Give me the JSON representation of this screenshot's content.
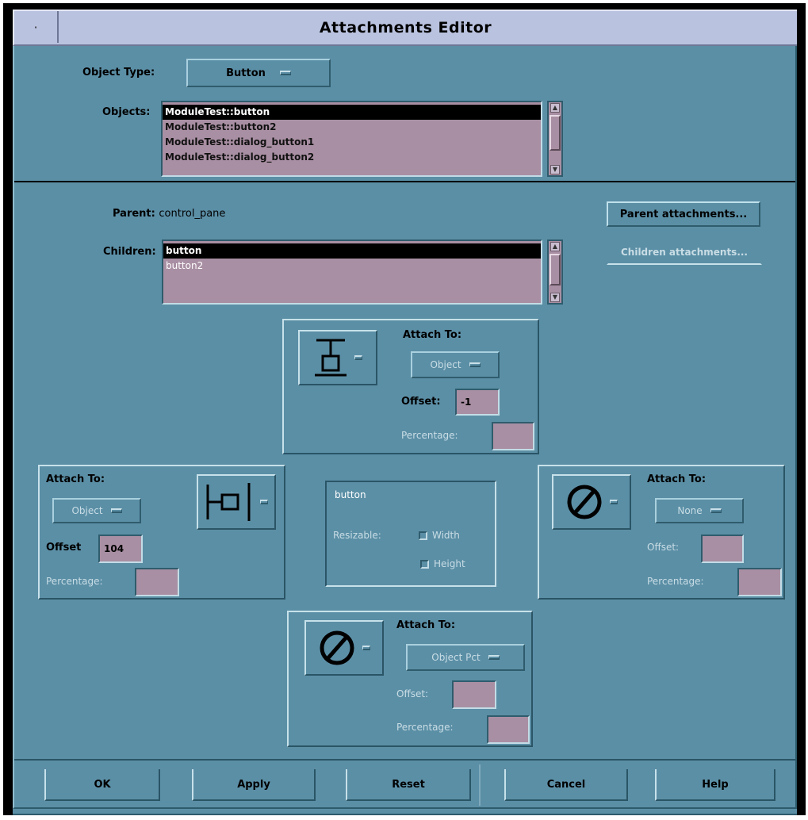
{
  "window": {
    "title": "Attachments Editor",
    "menu_glyph": "·"
  },
  "object_type": {
    "label": "Object Type:",
    "value": "Button"
  },
  "objects": {
    "label": "Objects:",
    "items": [
      "ModuleTest::button",
      "ModuleTest::button2",
      "ModuleTest::dialog_button1",
      "ModuleTest::dialog_button2"
    ],
    "selected_index": 0
  },
  "parent": {
    "label": "Parent:",
    "value": "control_pane",
    "attachments_button": "Parent attachments..."
  },
  "children": {
    "label": "Children:",
    "items": [
      "button",
      "button2"
    ],
    "selected_index": 0,
    "side_button": "Children attachments..."
  },
  "top_panel": {
    "attach_label": "Attach To:",
    "attach_value": "Object",
    "offset_label": "Offset:",
    "offset_value": "-1",
    "percentage_label": "Percentage:",
    "percentage_value": ""
  },
  "left_panel": {
    "attach_label": "Attach To:",
    "attach_value": "Object",
    "offset_label": "Offset",
    "offset_value": "104",
    "percentage_label": "Percentage:",
    "percentage_value": ""
  },
  "center_panel": {
    "object_name": "button",
    "resizable_label": "Resizable:",
    "width_label": "Width",
    "height_label": "Height"
  },
  "right_panel": {
    "attach_label": "Attach To:",
    "attach_value": "None",
    "offset_label": "Offset:",
    "offset_value": "",
    "percentage_label": "Percentage:",
    "percentage_value": ""
  },
  "bottom_panel": {
    "attach_label": "Attach To:",
    "attach_value": "Object Pct",
    "offset_label": "Offset:",
    "offset_value": "",
    "percentage_label": "Percentage:",
    "percentage_value": ""
  },
  "buttons": {
    "ok": "OK",
    "apply": "Apply",
    "reset": "Reset",
    "cancel": "Cancel",
    "help": "Help"
  }
}
